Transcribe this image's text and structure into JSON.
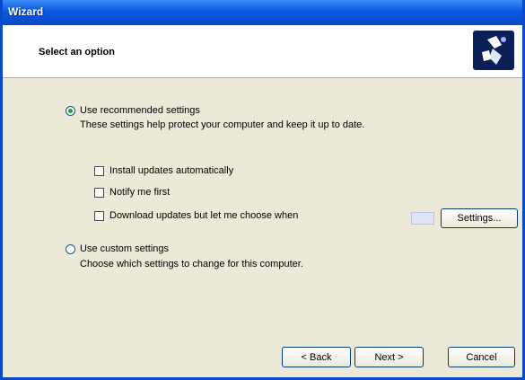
{
  "window": {
    "title": "Wizard"
  },
  "header": {
    "title": "Select an option",
    "icon": "wizard-icon"
  },
  "options": {
    "first": {
      "label": "Use recommended settings",
      "description": "These settings help protect your computer and keep it up to date."
    },
    "sub": [
      {
        "label": "Install updates automatically"
      },
      {
        "label": "Notify me first"
      },
      {
        "label": "Download updates but let me choose when"
      }
    ],
    "settings_button": "Settings...",
    "second": {
      "label": "Use custom settings",
      "description": "Choose which settings to change for this computer."
    }
  },
  "buttons": {
    "back": "< Back",
    "next": "Next >",
    "cancel": "Cancel"
  },
  "colors": {
    "titlebar": "#0a5ae0",
    "face": "#ece9d8"
  }
}
